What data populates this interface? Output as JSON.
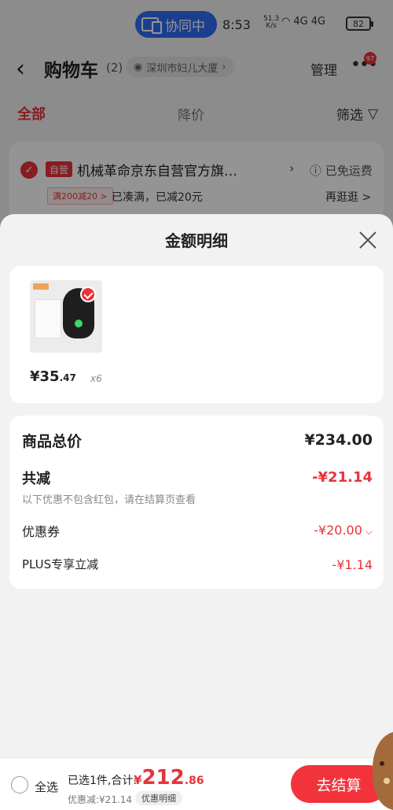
{
  "status_bar": {
    "collab_label": "协同中",
    "time": "8:53",
    "net_speed": "51.3",
    "net_unit": "K/s",
    "signal_1": "4G",
    "signal_2": "4G",
    "battery": "82"
  },
  "nav": {
    "back_icon": "chevron-left-icon",
    "title": "购物车",
    "count": "(2)",
    "location": "深圳市妇儿大厦",
    "location_icon": "eye-icon",
    "manage": "管理",
    "more_icon": "more-dots-icon",
    "message_badge": "97"
  },
  "filter": {
    "tab_all": "全部",
    "tab_price_drop": "降价",
    "filter_label": "筛选",
    "filter_icon": "filter-funnel-icon"
  },
  "shop": {
    "tag": "自营",
    "name": "机械革命京东自营官方旗…",
    "free_shipping": "已免运费",
    "promo_tag": "满200减20 >",
    "promo_text": "已凑满，已减20元",
    "more": "再逛逛 >"
  },
  "sheet": {
    "title": "金额明细",
    "close_icon": "close-icon",
    "product": {
      "image_icon": "mouse-product-image",
      "price_symbol": "¥",
      "price_int": "35",
      "price_dec": ".47",
      "quantity": "x6"
    },
    "details": {
      "total_label": "商品总价",
      "total_value": "¥234.00",
      "reduce_label": "共减",
      "reduce_value": "-¥21.14",
      "note": "以下优惠不包含红包，请在结算页查看",
      "coupon_label": "优惠券",
      "coupon_value": "-¥20.00",
      "plus_label": "PLUS专享立减",
      "plus_value": "-¥1.14"
    }
  },
  "checkout": {
    "select_all": "全选",
    "selected_text": "已选1件,合计:",
    "total_symbol": "¥",
    "total_int": "212",
    "total_dec": ".86",
    "discount_text": "优惠减:¥21.14",
    "detail_chip": "优惠明细",
    "button": "去结算"
  },
  "colors": {
    "accent_red": "#e8333a",
    "collab_blue": "#2f6bf5"
  }
}
